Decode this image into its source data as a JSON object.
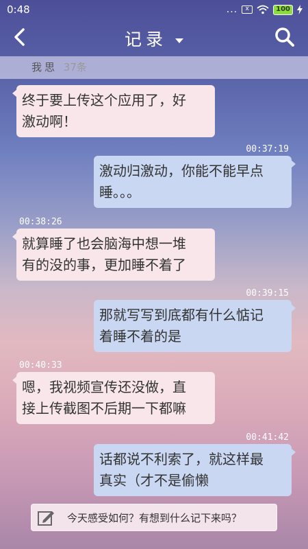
{
  "status_bar": {
    "time": "0:48",
    "dots": "...",
    "sim_label": "x",
    "battery": "100"
  },
  "header": {
    "title": "记录"
  },
  "filter": {
    "name": "我思",
    "count": "37条"
  },
  "messages": [
    {
      "side": "left",
      "time": "",
      "text_lines": [
        "终于要上传这个应用了，好",
        "激动啊！"
      ]
    },
    {
      "side": "right",
      "time": "00:37:19",
      "text_lines": [
        "激动归激动，你能不能早点",
        "睡。。。"
      ]
    },
    {
      "side": "left",
      "time": "00:38:26",
      "text_lines": [
        "就算睡了也会脑海中想一堆",
        "有的没的事，更加睡不着了"
      ]
    },
    {
      "side": "right",
      "time": "00:39:15",
      "text_lines": [
        "那就写写到底都有什么惦记",
        "着睡不着的是"
      ]
    },
    {
      "side": "left",
      "time": "00:40:33",
      "text_lines": [
        "嗯，我视频宣传还没做，直",
        "接上传截图不后期一下都嘛"
      ]
    },
    {
      "side": "right",
      "time": "00:41:42",
      "text_lines": [
        "话都说不利索了，就这样最",
        "真实（才不是偷懒"
      ]
    }
  ],
  "composer": {
    "placeholder": "今天感受如何？有想到什么记下来吗？"
  },
  "icons": {
    "back": "chevron-left-icon",
    "search": "search-icon",
    "dropdown": "caret-down-icon",
    "compose": "edit-icon",
    "wifi": "wifi-icon",
    "battery": "battery-icon",
    "charging": "bolt-icon"
  }
}
